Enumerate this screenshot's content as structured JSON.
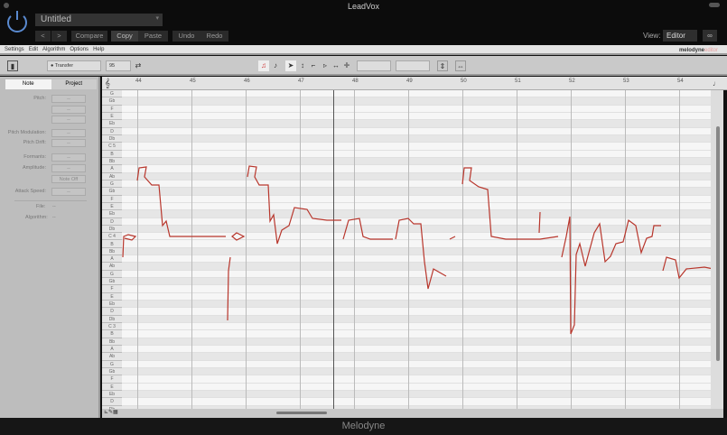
{
  "window": {
    "title": "LeadVox"
  },
  "header": {
    "preset": "Untitled",
    "buttons": {
      "prev": "<",
      "next": ">",
      "compare": "Compare",
      "copy": "Copy",
      "paste": "Paste",
      "undo": "Undo",
      "redo": "Redo"
    },
    "view_label": "View:",
    "view_value": "Editor"
  },
  "menu": [
    "Settings",
    "Edit",
    "Algorithm",
    "Options",
    "Help"
  ],
  "brand": {
    "name": "melodyne",
    "edition": "editor"
  },
  "toolbar": {
    "transfer": "Transfer",
    "tempo": "95"
  },
  "inspector": {
    "tabs": [
      "Note",
      "Project"
    ],
    "pitch": "Pitch:",
    "pitch_mod": "Pitch Modulation:",
    "pitch_drift": "Pitch Drift:",
    "formants": "Formants:",
    "amplitude": "Amplitude:",
    "note_off": "Note Off",
    "attack": "Attack Speed:",
    "file": "File:",
    "algorithm": "Algorithm:",
    "dash": "--"
  },
  "ruler": {
    "bars": [
      "44",
      "45",
      "46",
      "47",
      "48",
      "49",
      "50",
      "51",
      "52",
      "53",
      "54"
    ]
  },
  "keys": [
    "G",
    "Gb",
    "F",
    "E",
    "Eb",
    "D",
    "Db",
    "C 5",
    "B",
    "Bb",
    "A",
    "Ab",
    "G",
    "Gb",
    "F",
    "E",
    "Eb",
    "D",
    "Db",
    "C 4",
    "B",
    "Bb",
    "A",
    "Ab",
    "G",
    "Gb",
    "F",
    "E",
    "Eb",
    "D",
    "Db",
    "C 3",
    "B",
    "Bb",
    "A",
    "Ab",
    "G",
    "Gb",
    "F",
    "E",
    "Eb",
    "D",
    "Db"
  ],
  "footer": {
    "label": "Melodyne"
  },
  "colors": {
    "accent": "#5a8ad0",
    "blob": "#b8362c"
  }
}
